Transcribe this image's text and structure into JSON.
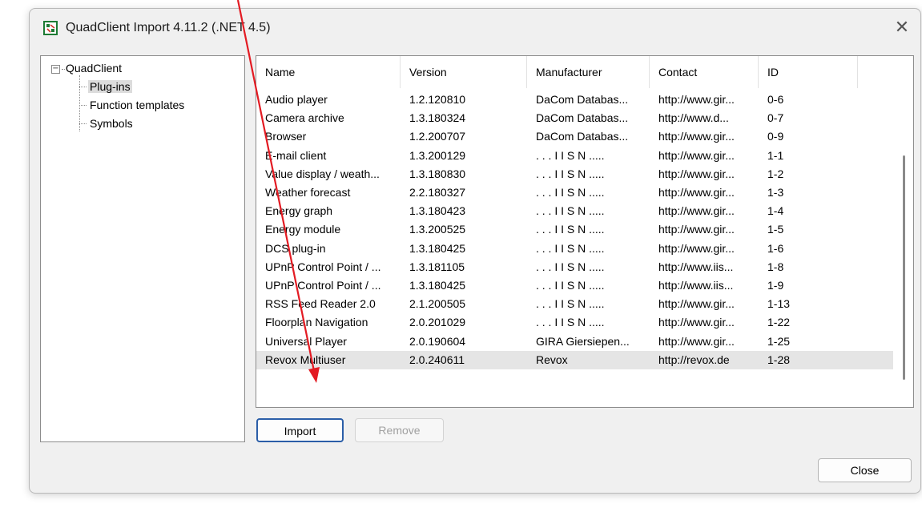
{
  "window": {
    "title": "QuadClient Import 4.11.2 (.NET 4.5)",
    "close_glyph": "✕"
  },
  "tree": {
    "expander_glyph": "−",
    "root_label": "QuadClient",
    "items": [
      {
        "label": "Plug-ins",
        "selected": true
      },
      {
        "label": "Function templates",
        "selected": false
      },
      {
        "label": "Symbols",
        "selected": false
      }
    ]
  },
  "plugin_table": {
    "sort_indicator": "^",
    "columns": [
      "Name",
      "Version",
      "Manufacturer",
      "Contact",
      "ID"
    ],
    "rows": [
      [
        "Audio player",
        "1.2.120810",
        "DaCom Databas...",
        "http://www.gir...",
        "0-6"
      ],
      [
        "Camera archive",
        "1.3.180324",
        "DaCom Databas...",
        "http://www.d...",
        "0-7"
      ],
      [
        "Browser",
        "1.2.200707",
        "DaCom Databas...",
        "http://www.gir...",
        "0-9"
      ],
      [
        "E-mail client",
        "1.3.200129",
        ". . . I I S N .....",
        "http://www.gir...",
        "1-1"
      ],
      [
        "Value display / weath...",
        "1.3.180830",
        ". . . I I S N .....",
        "http://www.gir...",
        "1-2"
      ],
      [
        "Weather forecast",
        "2.2.180327",
        ". . . I I S N .....",
        "http://www.gir...",
        "1-3"
      ],
      [
        "Energy graph",
        "1.3.180423",
        ". . . I I S N .....",
        "http://www.gir...",
        "1-4"
      ],
      [
        "Energy module",
        "1.3.200525",
        ". . . I I S N .....",
        "http://www.gir...",
        "1-5"
      ],
      [
        "DCS plug-in",
        "1.3.180425",
        ". . . I I S N .....",
        "http://www.gir...",
        "1-6"
      ],
      [
        "UPnP Control Point / ...",
        "1.3.181105",
        ". . . I I S N .....",
        "http://www.iis...",
        "1-8"
      ],
      [
        "UPnP Control Point / ...",
        "1.3.180425",
        ". . . I I S N .....",
        "http://www.iis...",
        "1-9"
      ],
      [
        "RSS Feed Reader 2.0",
        "2.1.200505",
        ". . . I I S N .....",
        "http://www.gir...",
        "1-13"
      ],
      [
        "Floorplan Navigation",
        "2.0.201029",
        ". . . I I S N .....",
        "http://www.gir...",
        "1-22"
      ],
      [
        "Universal Player",
        "2.0.190604",
        "GIRA Giersiepen...",
        "http://www.gir...",
        "1-25"
      ],
      [
        "Revox Multiuser",
        "2.0.240611",
        "Revox",
        "http://revox.de",
        "1-28"
      ]
    ],
    "selected_row_index": 14
  },
  "buttons": {
    "import": "Import",
    "remove": "Remove",
    "close": "Close"
  },
  "colors": {
    "annotation_arrow": "#e31b23",
    "default_button_border": "#2b5ea8",
    "icon_green": "#1e7b34",
    "icon_red": "#d0342c"
  }
}
